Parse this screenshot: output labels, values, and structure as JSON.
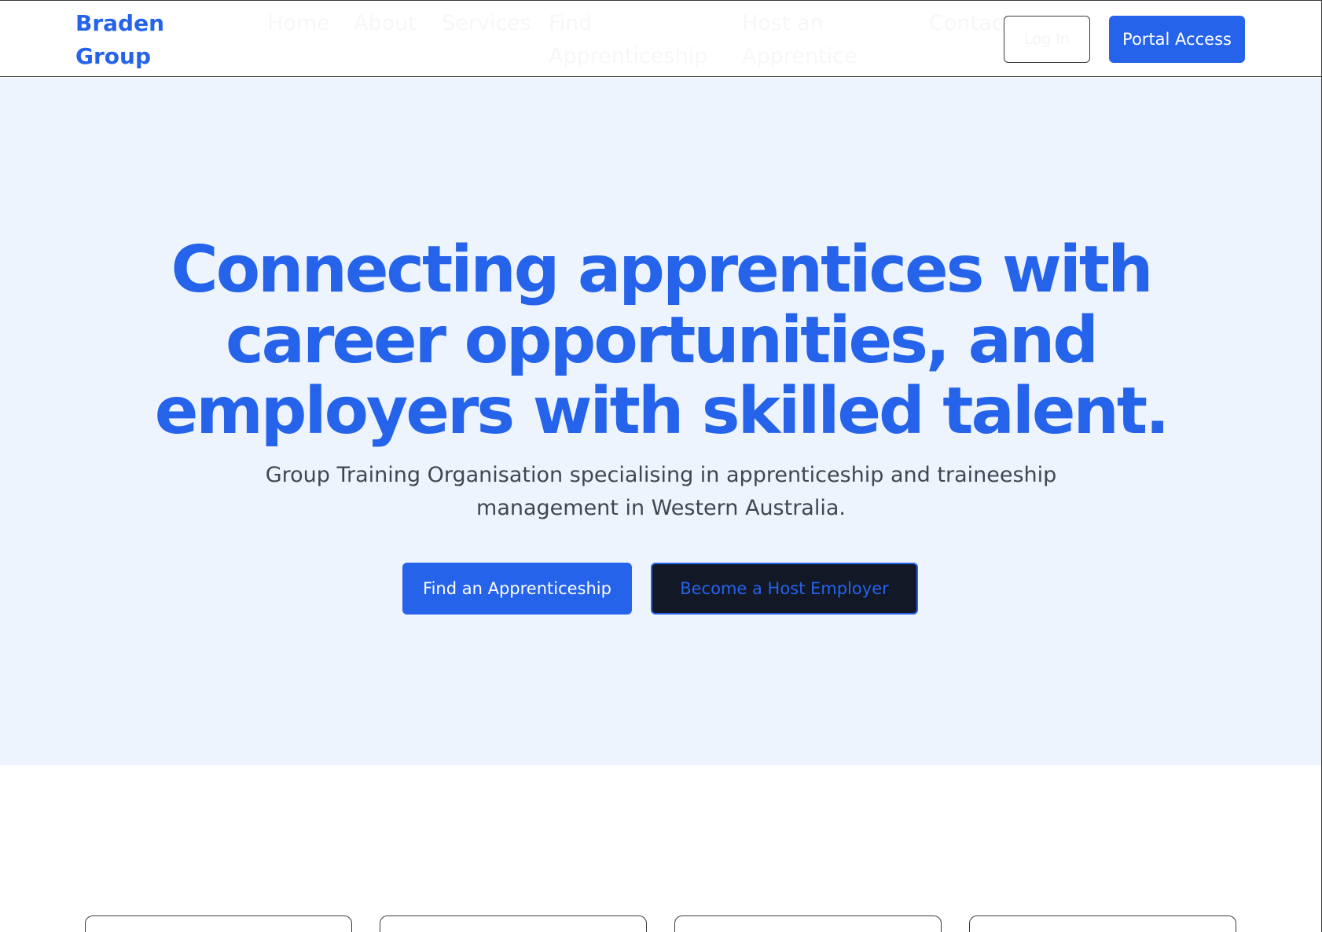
{
  "header": {
    "brand": "Braden Group",
    "nav": [
      {
        "label": "Home"
      },
      {
        "label": "About"
      },
      {
        "label": "Services"
      },
      {
        "label": "Find Apprenticeship"
      },
      {
        "label": "Host an Apprentice"
      },
      {
        "label": "Contact"
      }
    ],
    "login_label": "Log In",
    "portal_label": "Portal Access"
  },
  "hero": {
    "title": "Connecting apprentices with career opportunities, and employers with skilled talent.",
    "subtitle": "Group Training Organisation specialising in apprenticeship and traineeship management in Western Australia.",
    "primary_cta": "Find an Apprenticeship",
    "secondary_cta": "Become a Host Employer"
  },
  "colors": {
    "accent": "#2563eb",
    "hero_background": "#eef4fd",
    "dark_button": "#121826"
  }
}
